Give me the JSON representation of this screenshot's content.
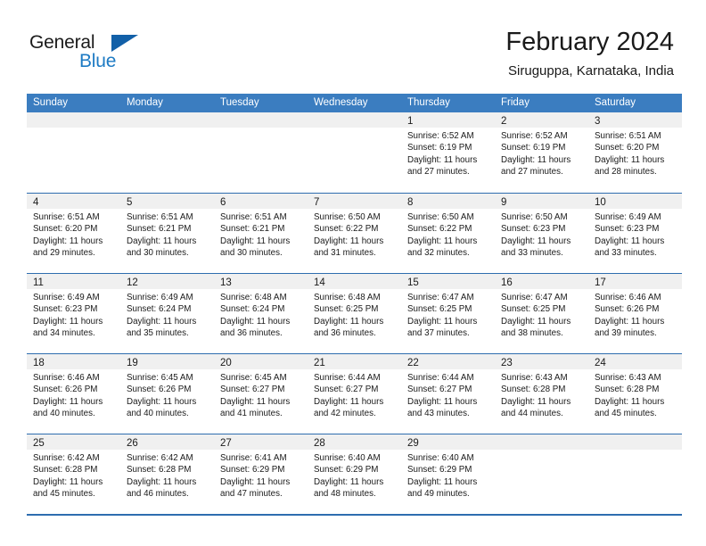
{
  "brand": {
    "name_part1": "General",
    "name_part2": "Blue",
    "triangle_color": "#1260a8",
    "blue_color": "#1e7bc4"
  },
  "header": {
    "title": "February 2024",
    "subtitle": "Siruguppa, Karnataka, India"
  },
  "theme": {
    "header_blue": "#3b7dc0",
    "rule_blue": "#2e6daf",
    "date_band_gray": "#f0f0f0"
  },
  "weekdays": [
    "Sunday",
    "Monday",
    "Tuesday",
    "Wednesday",
    "Thursday",
    "Friday",
    "Saturday"
  ],
  "weeks": [
    [
      {
        "date": "",
        "lines": []
      },
      {
        "date": "",
        "lines": []
      },
      {
        "date": "",
        "lines": []
      },
      {
        "date": "",
        "lines": []
      },
      {
        "date": "1",
        "lines": [
          "Sunrise: 6:52 AM",
          "Sunset: 6:19 PM",
          "Daylight: 11 hours",
          "and 27 minutes."
        ]
      },
      {
        "date": "2",
        "lines": [
          "Sunrise: 6:52 AM",
          "Sunset: 6:19 PM",
          "Daylight: 11 hours",
          "and 27 minutes."
        ]
      },
      {
        "date": "3",
        "lines": [
          "Sunrise: 6:51 AM",
          "Sunset: 6:20 PM",
          "Daylight: 11 hours",
          "and 28 minutes."
        ]
      }
    ],
    [
      {
        "date": "4",
        "lines": [
          "Sunrise: 6:51 AM",
          "Sunset: 6:20 PM",
          "Daylight: 11 hours",
          "and 29 minutes."
        ]
      },
      {
        "date": "5",
        "lines": [
          "Sunrise: 6:51 AM",
          "Sunset: 6:21 PM",
          "Daylight: 11 hours",
          "and 30 minutes."
        ]
      },
      {
        "date": "6",
        "lines": [
          "Sunrise: 6:51 AM",
          "Sunset: 6:21 PM",
          "Daylight: 11 hours",
          "and 30 minutes."
        ]
      },
      {
        "date": "7",
        "lines": [
          "Sunrise: 6:50 AM",
          "Sunset: 6:22 PM",
          "Daylight: 11 hours",
          "and 31 minutes."
        ]
      },
      {
        "date": "8",
        "lines": [
          "Sunrise: 6:50 AM",
          "Sunset: 6:22 PM",
          "Daylight: 11 hours",
          "and 32 minutes."
        ]
      },
      {
        "date": "9",
        "lines": [
          "Sunrise: 6:50 AM",
          "Sunset: 6:23 PM",
          "Daylight: 11 hours",
          "and 33 minutes."
        ]
      },
      {
        "date": "10",
        "lines": [
          "Sunrise: 6:49 AM",
          "Sunset: 6:23 PM",
          "Daylight: 11 hours",
          "and 33 minutes."
        ]
      }
    ],
    [
      {
        "date": "11",
        "lines": [
          "Sunrise: 6:49 AM",
          "Sunset: 6:23 PM",
          "Daylight: 11 hours",
          "and 34 minutes."
        ]
      },
      {
        "date": "12",
        "lines": [
          "Sunrise: 6:49 AM",
          "Sunset: 6:24 PM",
          "Daylight: 11 hours",
          "and 35 minutes."
        ]
      },
      {
        "date": "13",
        "lines": [
          "Sunrise: 6:48 AM",
          "Sunset: 6:24 PM",
          "Daylight: 11 hours",
          "and 36 minutes."
        ]
      },
      {
        "date": "14",
        "lines": [
          "Sunrise: 6:48 AM",
          "Sunset: 6:25 PM",
          "Daylight: 11 hours",
          "and 36 minutes."
        ]
      },
      {
        "date": "15",
        "lines": [
          "Sunrise: 6:47 AM",
          "Sunset: 6:25 PM",
          "Daylight: 11 hours",
          "and 37 minutes."
        ]
      },
      {
        "date": "16",
        "lines": [
          "Sunrise: 6:47 AM",
          "Sunset: 6:25 PM",
          "Daylight: 11 hours",
          "and 38 minutes."
        ]
      },
      {
        "date": "17",
        "lines": [
          "Sunrise: 6:46 AM",
          "Sunset: 6:26 PM",
          "Daylight: 11 hours",
          "and 39 minutes."
        ]
      }
    ],
    [
      {
        "date": "18",
        "lines": [
          "Sunrise: 6:46 AM",
          "Sunset: 6:26 PM",
          "Daylight: 11 hours",
          "and 40 minutes."
        ]
      },
      {
        "date": "19",
        "lines": [
          "Sunrise: 6:45 AM",
          "Sunset: 6:26 PM",
          "Daylight: 11 hours",
          "and 40 minutes."
        ]
      },
      {
        "date": "20",
        "lines": [
          "Sunrise: 6:45 AM",
          "Sunset: 6:27 PM",
          "Daylight: 11 hours",
          "and 41 minutes."
        ]
      },
      {
        "date": "21",
        "lines": [
          "Sunrise: 6:44 AM",
          "Sunset: 6:27 PM",
          "Daylight: 11 hours",
          "and 42 minutes."
        ]
      },
      {
        "date": "22",
        "lines": [
          "Sunrise: 6:44 AM",
          "Sunset: 6:27 PM",
          "Daylight: 11 hours",
          "and 43 minutes."
        ]
      },
      {
        "date": "23",
        "lines": [
          "Sunrise: 6:43 AM",
          "Sunset: 6:28 PM",
          "Daylight: 11 hours",
          "and 44 minutes."
        ]
      },
      {
        "date": "24",
        "lines": [
          "Sunrise: 6:43 AM",
          "Sunset: 6:28 PM",
          "Daylight: 11 hours",
          "and 45 minutes."
        ]
      }
    ],
    [
      {
        "date": "25",
        "lines": [
          "Sunrise: 6:42 AM",
          "Sunset: 6:28 PM",
          "Daylight: 11 hours",
          "and 45 minutes."
        ]
      },
      {
        "date": "26",
        "lines": [
          "Sunrise: 6:42 AM",
          "Sunset: 6:28 PM",
          "Daylight: 11 hours",
          "and 46 minutes."
        ]
      },
      {
        "date": "27",
        "lines": [
          "Sunrise: 6:41 AM",
          "Sunset: 6:29 PM",
          "Daylight: 11 hours",
          "and 47 minutes."
        ]
      },
      {
        "date": "28",
        "lines": [
          "Sunrise: 6:40 AM",
          "Sunset: 6:29 PM",
          "Daylight: 11 hours",
          "and 48 minutes."
        ]
      },
      {
        "date": "29",
        "lines": [
          "Sunrise: 6:40 AM",
          "Sunset: 6:29 PM",
          "Daylight: 11 hours",
          "and 49 minutes."
        ]
      },
      {
        "date": "",
        "lines": []
      },
      {
        "date": "",
        "lines": []
      }
    ]
  ]
}
